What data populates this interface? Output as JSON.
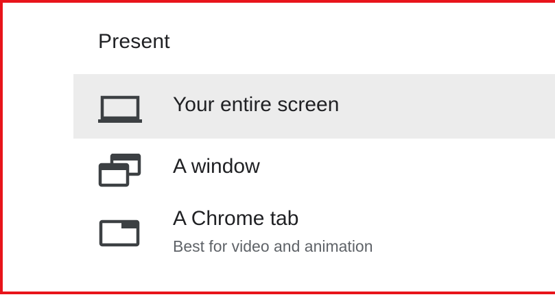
{
  "menu": {
    "title": "Present",
    "items": [
      {
        "label": "Your entire screen",
        "icon": "laptop-icon",
        "selected": true
      },
      {
        "label": "A window",
        "icon": "window-icon",
        "selected": false
      },
      {
        "label": "A Chrome tab",
        "sublabel": "Best for video and animation",
        "icon": "chrome-tab-icon",
        "selected": false
      }
    ]
  },
  "colors": {
    "frame_border": "#e8141b",
    "selected_bg": "#ececec",
    "text_primary": "#202124",
    "text_secondary": "#5f6368",
    "icon": "#3c4043"
  }
}
